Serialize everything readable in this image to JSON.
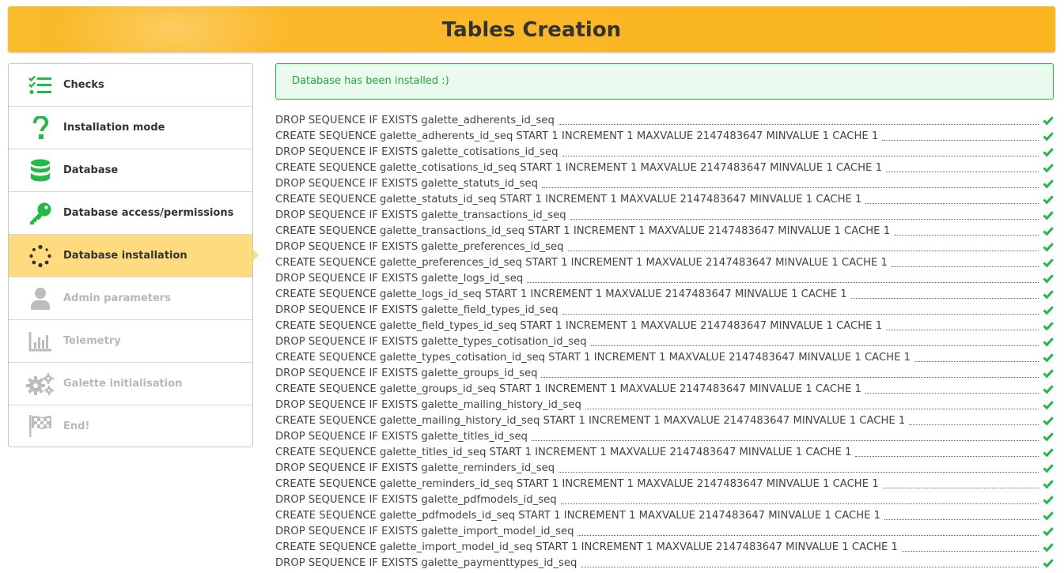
{
  "header": {
    "title": "Tables Creation"
  },
  "steps": [
    {
      "label": "Checks",
      "icon": "checklist-icon",
      "state": "done"
    },
    {
      "label": "Installation mode",
      "icon": "question-icon",
      "state": "done"
    },
    {
      "label": "Database",
      "icon": "database-icon",
      "state": "done"
    },
    {
      "label": "Database access/permissions",
      "icon": "key-icon",
      "state": "done"
    },
    {
      "label": "Database installation",
      "icon": "spinner-icon",
      "state": "active"
    },
    {
      "label": "Admin parameters",
      "icon": "user-icon",
      "state": "todo"
    },
    {
      "label": "Telemetry",
      "icon": "bar-chart-icon",
      "state": "todo"
    },
    {
      "label": "Galette initialisation",
      "icon": "cogs-icon",
      "state": "todo"
    },
    {
      "label": "End!",
      "icon": "flag-checkered-icon",
      "state": "todo"
    }
  ],
  "message": {
    "text": "Database has been installed :)"
  },
  "colors": {
    "accent": "#fbb829",
    "active_step": "#fedb7e",
    "success": "#21ba45",
    "icon_green": "#21ba45",
    "icon_grey": "#bcbcbc"
  },
  "log": [
    "DROP SEQUENCE IF EXISTS galette_adherents_id_seq",
    "CREATE SEQUENCE galette_adherents_id_seq START 1 INCREMENT 1 MAXVALUE 2147483647 MINVALUE 1 CACHE 1",
    "DROP SEQUENCE IF EXISTS galette_cotisations_id_seq",
    "CREATE SEQUENCE galette_cotisations_id_seq START 1 INCREMENT 1 MAXVALUE 2147483647 MINVALUE 1 CACHE 1",
    "DROP SEQUENCE IF EXISTS galette_statuts_id_seq",
    "CREATE SEQUENCE galette_statuts_id_seq START 1 INCREMENT 1 MAXVALUE 2147483647 MINVALUE 1 CACHE 1",
    "DROP SEQUENCE IF EXISTS galette_transactions_id_seq",
    "CREATE SEQUENCE galette_transactions_id_seq START 1 INCREMENT 1 MAXVALUE 2147483647 MINVALUE 1 CACHE 1",
    "DROP SEQUENCE IF EXISTS galette_preferences_id_seq",
    "CREATE SEQUENCE galette_preferences_id_seq START 1 INCREMENT 1 MAXVALUE 2147483647 MINVALUE 1 CACHE 1",
    "DROP SEQUENCE IF EXISTS galette_logs_id_seq",
    "CREATE SEQUENCE galette_logs_id_seq START 1 INCREMENT 1 MAXVALUE 2147483647 MINVALUE 1 CACHE 1",
    "DROP SEQUENCE IF EXISTS galette_field_types_id_seq",
    "CREATE SEQUENCE galette_field_types_id_seq START 1 INCREMENT 1 MAXVALUE 2147483647 MINVALUE 1 CACHE 1",
    "DROP SEQUENCE IF EXISTS galette_types_cotisation_id_seq",
    "CREATE SEQUENCE galette_types_cotisation_id_seq START 1 INCREMENT 1 MAXVALUE 2147483647 MINVALUE 1 CACHE 1",
    "DROP SEQUENCE IF EXISTS galette_groups_id_seq",
    "CREATE SEQUENCE galette_groups_id_seq START 1 INCREMENT 1 MAXVALUE 2147483647 MINVALUE 1 CACHE 1",
    "DROP SEQUENCE IF EXISTS galette_mailing_history_id_seq",
    "CREATE SEQUENCE galette_mailing_history_id_seq START 1 INCREMENT 1 MAXVALUE 2147483647 MINVALUE 1 CACHE 1",
    "DROP SEQUENCE IF EXISTS galette_titles_id_seq",
    "CREATE SEQUENCE galette_titles_id_seq START 1 INCREMENT 1 MAXVALUE 2147483647 MINVALUE 1 CACHE 1",
    "DROP SEQUENCE IF EXISTS galette_reminders_id_seq",
    "CREATE SEQUENCE galette_reminders_id_seq START 1 INCREMENT 1 MAXVALUE 2147483647 MINVALUE 1 CACHE 1",
    "DROP SEQUENCE IF EXISTS galette_pdfmodels_id_seq",
    "CREATE SEQUENCE galette_pdfmodels_id_seq START 1 INCREMENT 1 MAXVALUE 2147483647 MINVALUE 1 CACHE 1",
    "DROP SEQUENCE IF EXISTS galette_import_model_id_seq",
    "CREATE SEQUENCE galette_import_model_id_seq START 1 INCREMENT 1 MAXVALUE 2147483647 MINVALUE 1 CACHE 1",
    "DROP SEQUENCE IF EXISTS galette_paymenttypes_id_seq"
  ]
}
